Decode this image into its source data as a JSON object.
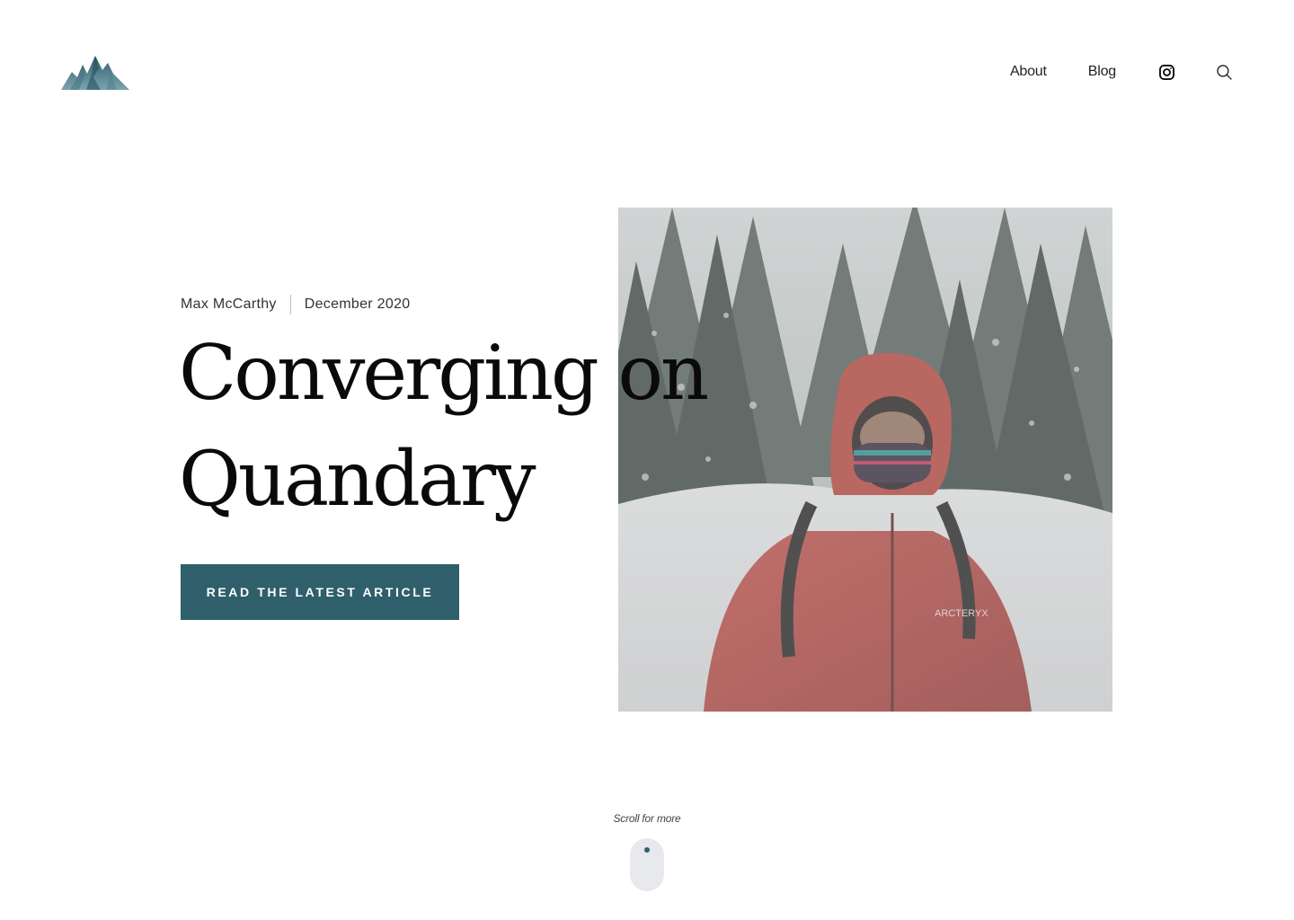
{
  "header": {
    "logo_name": "mountain-logo",
    "nav": [
      {
        "label": "About"
      },
      {
        "label": "Blog"
      }
    ],
    "icons": [
      "instagram-icon",
      "search-icon"
    ]
  },
  "hero": {
    "author": "Max McCarthy",
    "date": "December 2020",
    "title_line1": "Converging on",
    "title_line2": "Quandary",
    "cta_label": "Read the latest article",
    "image": {
      "subject": "hero-photo",
      "jacket_text": "ARCTERYX"
    }
  },
  "scroll": {
    "label": "Scroll for more"
  },
  "colors": {
    "accent": "#2f5f6b",
    "background": "#ffffff",
    "text": "#0a0a0a",
    "mouse_bg": "#e7e9ec"
  }
}
